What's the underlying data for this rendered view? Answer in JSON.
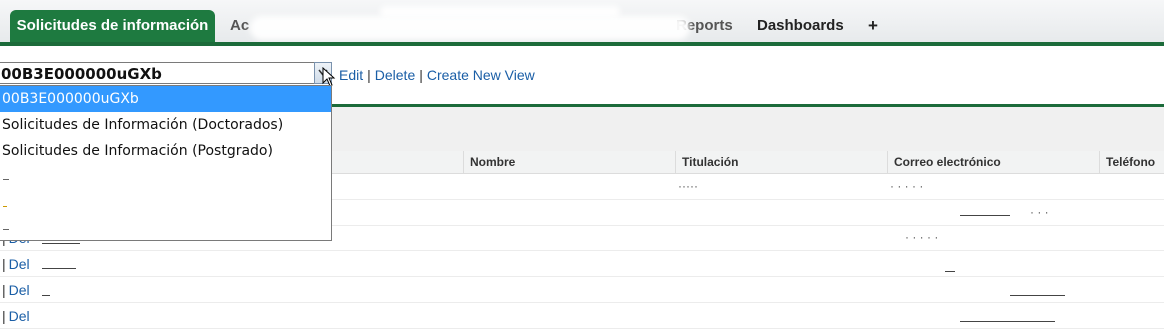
{
  "tabs": {
    "active": "Solicitudes de información",
    "partial_1": "Ac",
    "partial_2": "Reports",
    "dashboards": "Dashboards",
    "add": "+"
  },
  "view": {
    "selected": "00B3E000000uGXb",
    "links": {
      "edit": "Edit",
      "delete": "Delete",
      "create": "Create New View"
    },
    "separator": "|",
    "options": [
      "00B3E000000uGXb",
      "Solicitudes de Información (Doctorados)",
      "Solicitudes de Información (Postgrado)"
    ]
  },
  "table": {
    "columns": [
      "Nombre",
      "Titulación",
      "Correo electrónico",
      "Teléfono"
    ],
    "row_prefix": "|",
    "row_action": "Del",
    "rows_visible": 4
  },
  "colors": {
    "accent_green": "#1e7a40",
    "link_blue": "#1a5ea6",
    "selection_blue": "#3399ff"
  }
}
